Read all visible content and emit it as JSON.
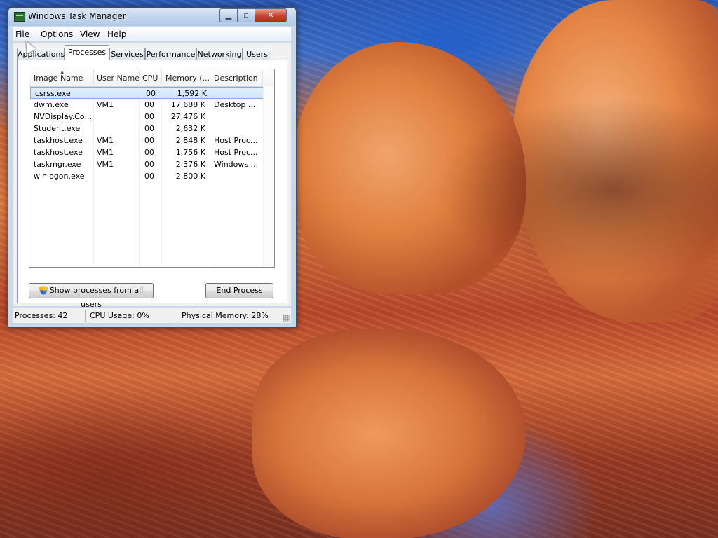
{
  "window": {
    "title": "Windows Task Manager"
  },
  "menu": [
    "File",
    "Options",
    "View",
    "Help"
  ],
  "tabs": [
    {
      "label": "Applications",
      "active": false
    },
    {
      "label": "Processes",
      "active": true
    },
    {
      "label": "Services",
      "active": false
    },
    {
      "label": "Performance",
      "active": false
    },
    {
      "label": "Networking",
      "active": false
    },
    {
      "label": "Users",
      "active": false
    }
  ],
  "columns": [
    "Image Name",
    "User Name",
    "CPU",
    "Memory (...",
    "Description"
  ],
  "processes": [
    {
      "name": "csrss.exe",
      "user": "",
      "cpu": "00",
      "memory": "1,592 K",
      "description": "",
      "selected": true
    },
    {
      "name": "dwm.exe",
      "user": "VM1",
      "cpu": "00",
      "memory": "17,688 K",
      "description": "Desktop ..."
    },
    {
      "name": "NVDisplay.Co...",
      "user": "",
      "cpu": "00",
      "memory": "27,476 K",
      "description": ""
    },
    {
      "name": "Student.exe",
      "user": "",
      "cpu": "00",
      "memory": "2,632 K",
      "description": ""
    },
    {
      "name": "taskhost.exe",
      "user": "VM1",
      "cpu": "00",
      "memory": "2,848 K",
      "description": "Host Proc..."
    },
    {
      "name": "taskhost.exe",
      "user": "VM1",
      "cpu": "00",
      "memory": "1,756 K",
      "description": "Host Proc..."
    },
    {
      "name": "taskmgr.exe",
      "user": "VM1",
      "cpu": "00",
      "memory": "2,376 K",
      "description": "Windows ..."
    },
    {
      "name": "winlogon.exe",
      "user": "",
      "cpu": "00",
      "memory": "2,800 K",
      "description": ""
    }
  ],
  "buttons": {
    "show_all": "Show processes from all users",
    "end_process": "End Process"
  },
  "status": {
    "processes": "Processes: 42",
    "cpu": "CPU Usage: 0%",
    "memory": "Physical Memory: 28%"
  },
  "icons": {
    "app": "task-manager-icon",
    "shield": "uac-shield-icon"
  },
  "colors": {
    "selection": "#cde4fb",
    "close": "#c7402a"
  }
}
